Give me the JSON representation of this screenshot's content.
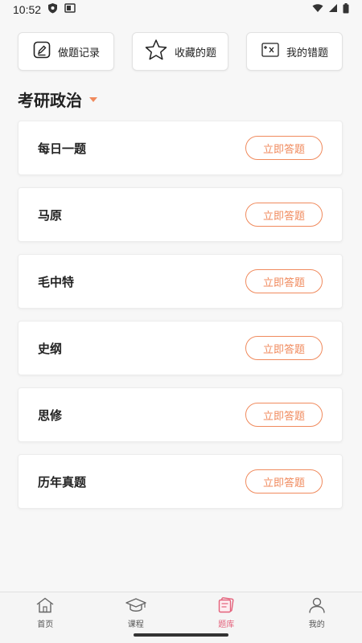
{
  "status_bar": {
    "time": "10:52"
  },
  "quick_actions": [
    {
      "label": "做题记录",
      "icon": "pencil-note-icon"
    },
    {
      "label": "收藏的题",
      "icon": "star-icon"
    },
    {
      "label": "我的错题",
      "icon": "wrong-answer-icon"
    }
  ],
  "subject": {
    "title": "考研政治",
    "caret_color": "#f08a5d"
  },
  "topics": [
    {
      "title": "每日一题",
      "button": "立即答题"
    },
    {
      "title": "马原",
      "button": "立即答题"
    },
    {
      "title": "毛中特",
      "button": "立即答题"
    },
    {
      "title": "史纲",
      "button": "立即答题"
    },
    {
      "title": "思修",
      "button": "立即答题"
    },
    {
      "title": "历年真题",
      "button": "立即答题"
    }
  ],
  "bottom_nav": [
    {
      "label": "首页",
      "icon": "home-icon",
      "active": false
    },
    {
      "label": "课程",
      "icon": "graduation-cap-icon",
      "active": false
    },
    {
      "label": "题库",
      "icon": "question-bank-icon",
      "active": true
    },
    {
      "label": "我的",
      "icon": "profile-icon",
      "active": false
    }
  ],
  "colors": {
    "accent": "#f08a5d",
    "nav_active": "#e4607a"
  }
}
